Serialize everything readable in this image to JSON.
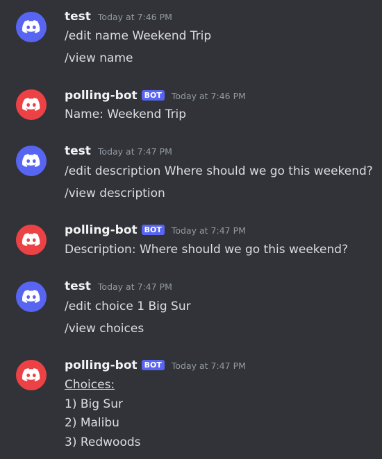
{
  "colors": {
    "background": "#313338",
    "user_avatar": "#5865f2",
    "bot_avatar": "#ed4245",
    "bot_tag": "#5865f2",
    "timestamp": "#949ba4",
    "text": "#dbdee1"
  },
  "messages": [
    {
      "author": "test",
      "avatar_icon": "discord-logo-icon",
      "timestamp": "Today at 7:46 PM",
      "lines": [
        "/edit name Weekend Trip",
        "/view name"
      ]
    },
    {
      "author": "polling-bot",
      "bot_tag": "BOT",
      "avatar_icon": "discord-logo-icon",
      "timestamp": "Today at 7:46 PM",
      "lines": [
        "Name: Weekend Trip"
      ]
    },
    {
      "author": "test",
      "avatar_icon": "discord-logo-icon",
      "timestamp": "Today at 7:47 PM",
      "lines": [
        "/edit description Where should we go this weekend?",
        "/view description"
      ]
    },
    {
      "author": "polling-bot",
      "bot_tag": "BOT",
      "avatar_icon": "discord-logo-icon",
      "timestamp": "Today at 7:47 PM",
      "lines": [
        "Description: Where should we go this weekend?"
      ]
    },
    {
      "author": "test",
      "avatar_icon": "discord-logo-icon",
      "timestamp": "Today at 7:47 PM",
      "lines": [
        "/edit choice 1 Big Sur",
        "/view choices"
      ]
    },
    {
      "author": "polling-bot",
      "bot_tag": "BOT",
      "avatar_icon": "discord-logo-icon",
      "timestamp": "Today at 7:47 PM",
      "lines": [
        "Choices:",
        "1) Big Sur",
        "2) Malibu",
        "3) Redwoods"
      ]
    }
  ]
}
